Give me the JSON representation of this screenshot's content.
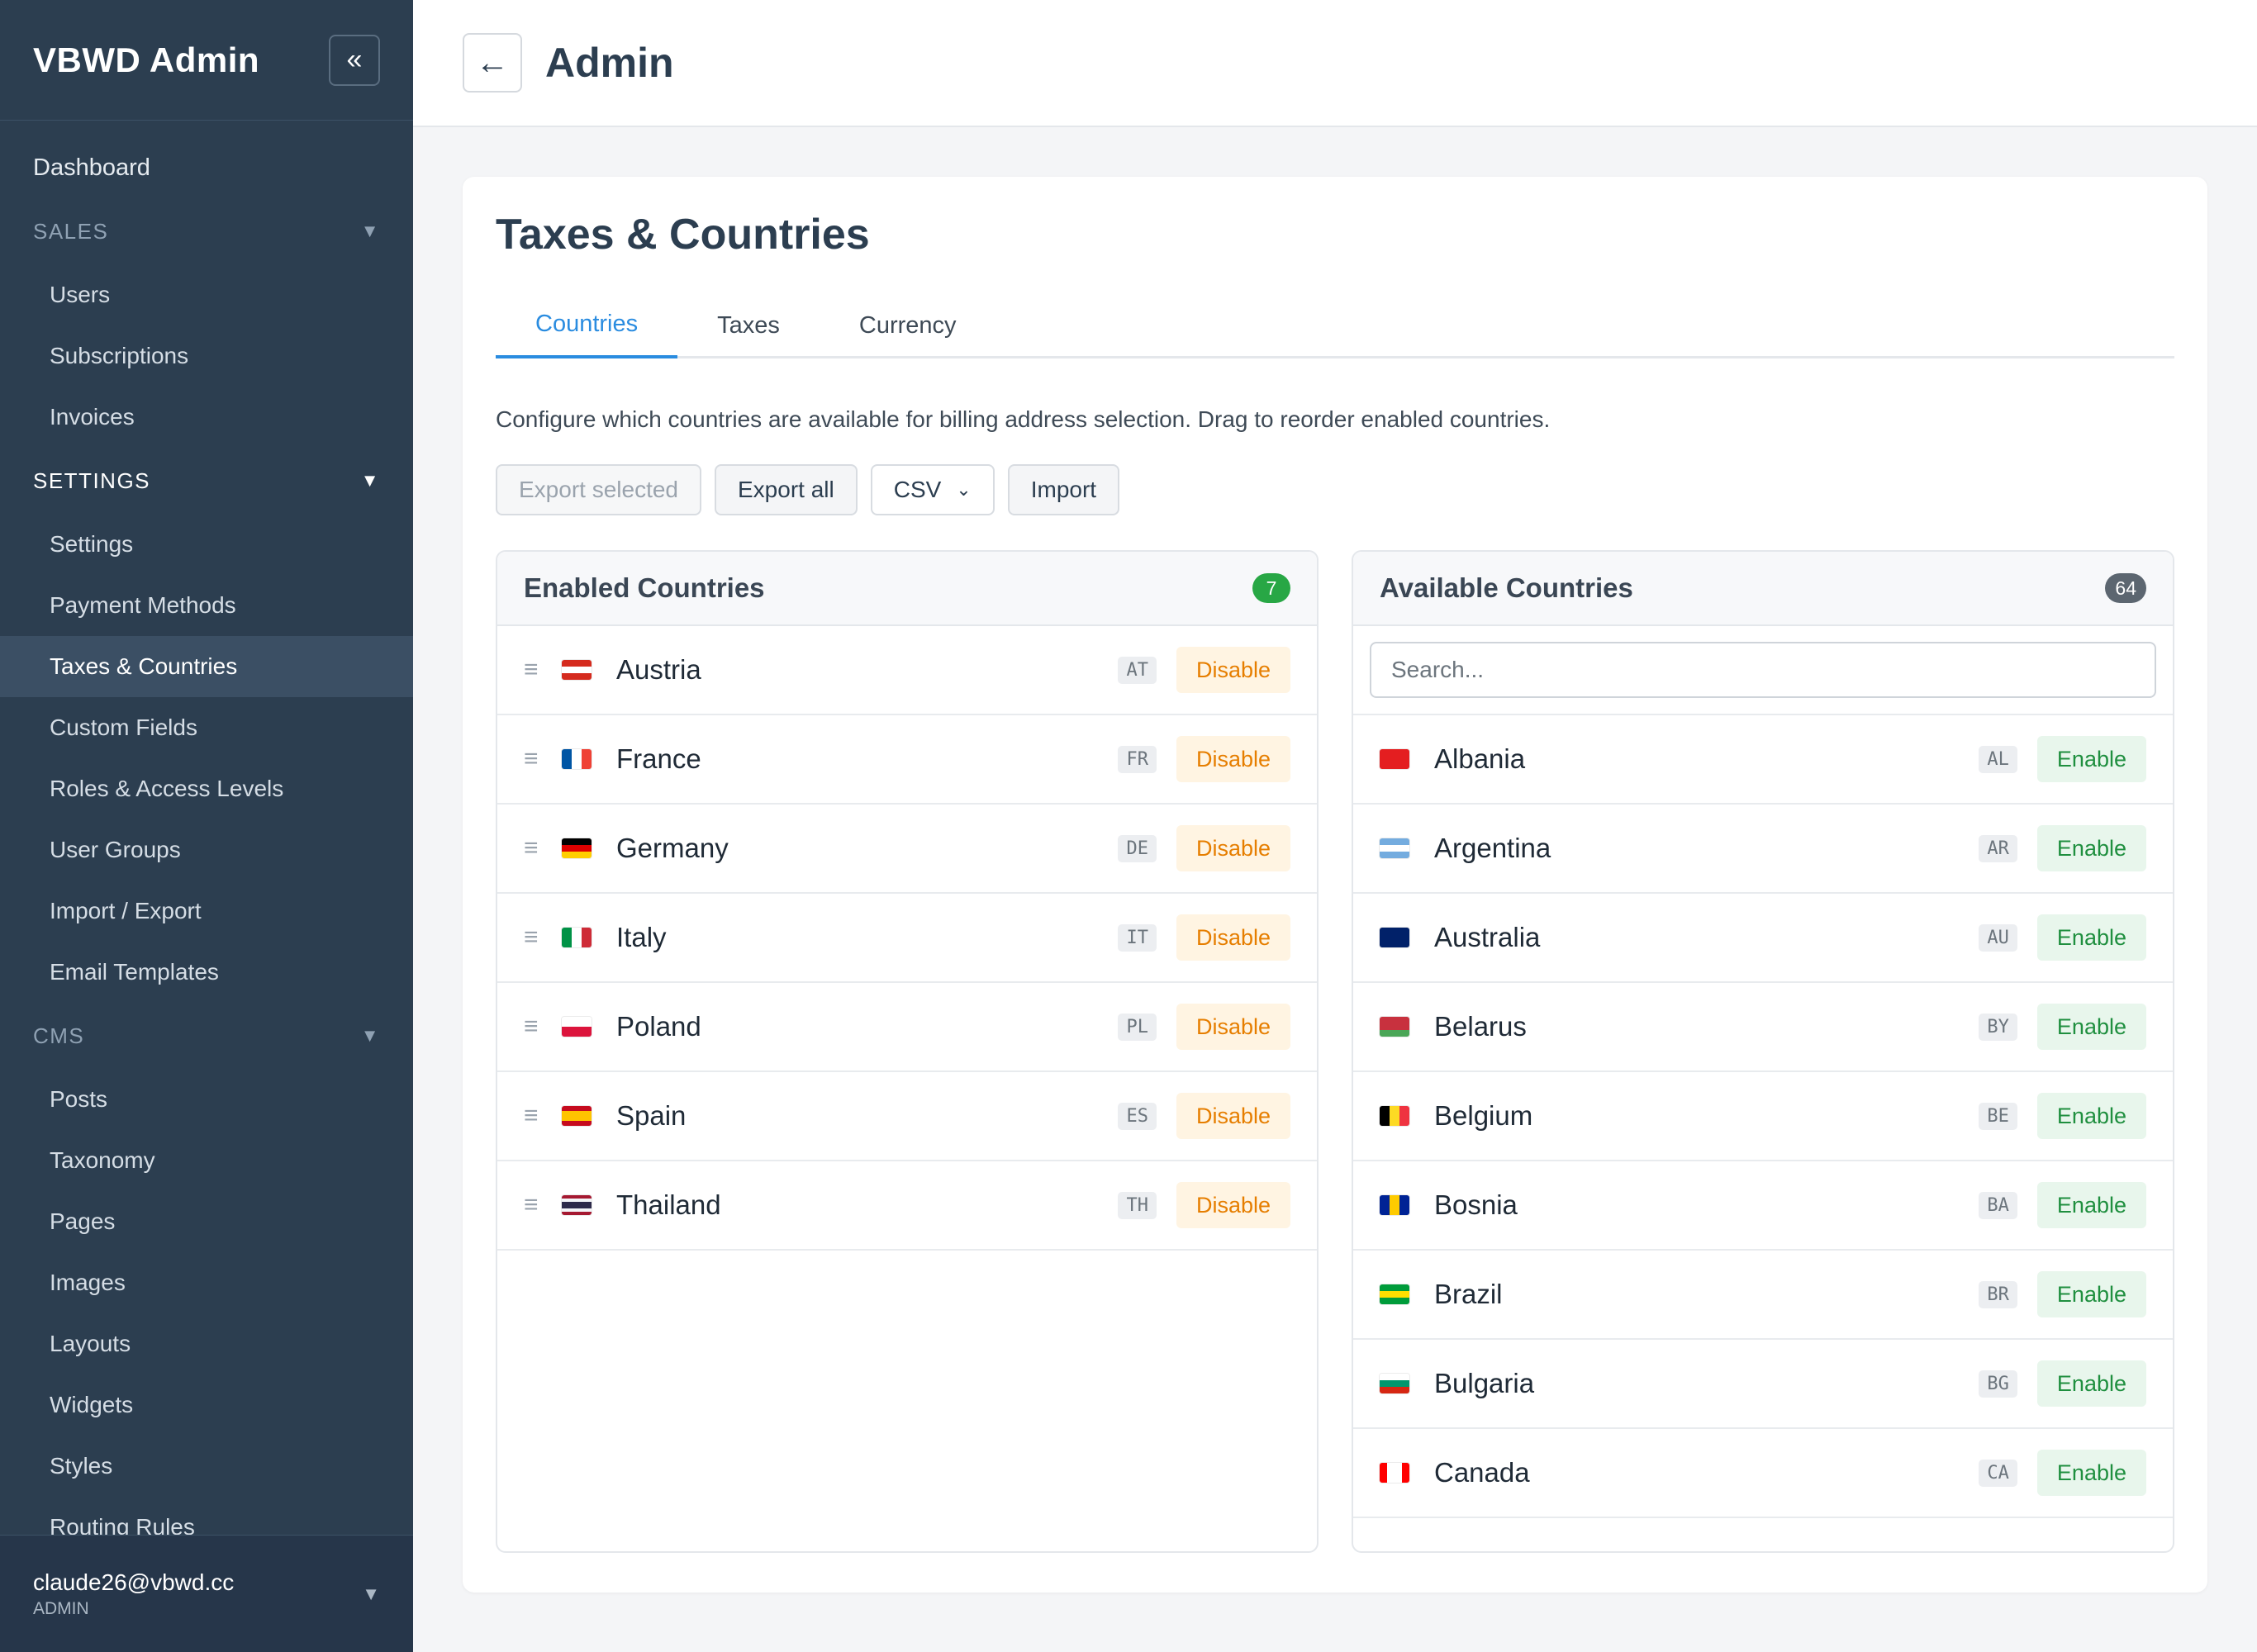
{
  "sidebar": {
    "brand": "VBWD Admin",
    "collapse_icon": "«",
    "dashboard": "Dashboard",
    "sections": {
      "sales": {
        "label": "SALES",
        "items": [
          "Users",
          "Subscriptions",
          "Invoices"
        ]
      },
      "settings": {
        "label": "SETTINGS",
        "items": [
          "Settings",
          "Payment Methods",
          "Taxes & Countries",
          "Custom Fields",
          "Roles & Access Levels",
          "User Groups",
          "Import / Export",
          "Email Templates"
        ]
      },
      "cms": {
        "label": "CMS",
        "items": [
          "Posts",
          "Taxonomy",
          "Pages",
          "Images",
          "Layouts",
          "Widgets",
          "Styles",
          "Routing Rules"
        ]
      }
    },
    "caret": "▼",
    "active_item": "Taxes & Countries",
    "user": {
      "email": "claude26@vbwd.cc",
      "role": "ADMIN"
    }
  },
  "topbar": {
    "back_icon": "←",
    "title": "Admin"
  },
  "page": {
    "title": "Taxes & Countries",
    "tabs": [
      "Countries",
      "Taxes",
      "Currency"
    ],
    "active_tab": "Countries",
    "description": "Configure which countries are available for billing address selection. Drag to reorder enabled countries.",
    "toolbar": {
      "export_selected": "Export selected",
      "export_all": "Export all",
      "format": "CSV",
      "import": "Import"
    }
  },
  "enabled": {
    "title": "Enabled Countries",
    "count": "7",
    "action_label": "Disable",
    "drag_icon": "≡",
    "countries": [
      {
        "name": "Austria",
        "code": "AT"
      },
      {
        "name": "France",
        "code": "FR"
      },
      {
        "name": "Germany",
        "code": "DE"
      },
      {
        "name": "Italy",
        "code": "IT"
      },
      {
        "name": "Poland",
        "code": "PL"
      },
      {
        "name": "Spain",
        "code": "ES"
      },
      {
        "name": "Thailand",
        "code": "TH"
      }
    ]
  },
  "available": {
    "title": "Available Countries",
    "count": "64",
    "search_placeholder": "Search...",
    "action_label": "Enable",
    "countries": [
      {
        "name": "Albania",
        "code": "AL"
      },
      {
        "name": "Argentina",
        "code": "AR"
      },
      {
        "name": "Australia",
        "code": "AU"
      },
      {
        "name": "Belarus",
        "code": "BY"
      },
      {
        "name": "Belgium",
        "code": "BE"
      },
      {
        "name": "Bosnia",
        "code": "BA"
      },
      {
        "name": "Brazil",
        "code": "BR"
      },
      {
        "name": "Bulgaria",
        "code": "BG"
      },
      {
        "name": "Canada",
        "code": "CA"
      }
    ]
  },
  "colors": {
    "sidebar_bg": "#2c3e50",
    "accent": "#2a8ce0",
    "disable": "#e67e00",
    "enable": "#1f8f3f",
    "count_green": "#28a745"
  }
}
